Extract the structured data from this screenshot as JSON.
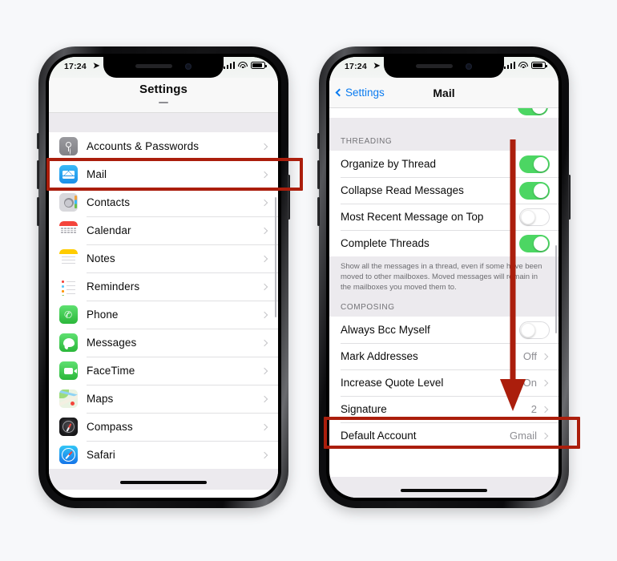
{
  "background_color": "#f7f8fa",
  "annotation_color": "#ab1e0c",
  "left_phone": {
    "status_bar": {
      "time": "17:24",
      "location_icon": "location-arrow-icon",
      "signal_icon": "cellular-bars-icon",
      "wifi_icon": "wifi-icon",
      "battery_icon": "battery-icon"
    },
    "nav": {
      "title": "Settings"
    },
    "items": [
      {
        "label": "Accounts & Passwords",
        "icon": "key-icon",
        "chevron": "chevron-right-icon"
      },
      {
        "label": "Mail",
        "icon": "mail-icon",
        "chevron": "chevron-right-icon",
        "highlighted": true
      },
      {
        "label": "Contacts",
        "icon": "contacts-icon",
        "chevron": "chevron-right-icon"
      },
      {
        "label": "Calendar",
        "icon": "calendar-icon",
        "chevron": "chevron-right-icon"
      },
      {
        "label": "Notes",
        "icon": "notes-icon",
        "chevron": "chevron-right-icon"
      },
      {
        "label": "Reminders",
        "icon": "reminders-icon",
        "chevron": "chevron-right-icon"
      },
      {
        "label": "Phone",
        "icon": "phone-icon",
        "chevron": "chevron-right-icon"
      },
      {
        "label": "Messages",
        "icon": "messages-icon",
        "chevron": "chevron-right-icon"
      },
      {
        "label": "FaceTime",
        "icon": "facetime-icon",
        "chevron": "chevron-right-icon"
      },
      {
        "label": "Maps",
        "icon": "maps-icon",
        "chevron": "chevron-right-icon"
      },
      {
        "label": "Compass",
        "icon": "compass-icon",
        "chevron": "chevron-right-icon"
      },
      {
        "label": "Safari",
        "icon": "safari-icon",
        "chevron": "chevron-right-icon"
      }
    ]
  },
  "right_phone": {
    "status_bar": {
      "time": "17:24",
      "location_icon": "location-arrow-icon",
      "signal_icon": "cellular-bars-icon",
      "wifi_icon": "wifi-icon",
      "battery_icon": "battery-icon"
    },
    "nav": {
      "back_label": "Settings",
      "title": "Mail"
    },
    "threading": {
      "header": "THREADING",
      "rows": [
        {
          "label": "Organize by Thread",
          "control": "toggle",
          "state": "on"
        },
        {
          "label": "Collapse Read Messages",
          "control": "toggle",
          "state": "on"
        },
        {
          "label": "Most Recent Message on Top",
          "control": "toggle",
          "state": "off"
        },
        {
          "label": "Complete Threads",
          "control": "toggle",
          "state": "on"
        }
      ],
      "footnote": "Show all the messages in a thread, even if some have been moved to other mailboxes. Moved messages will remain in the mailboxes you moved them to."
    },
    "composing": {
      "header": "COMPOSING",
      "rows": [
        {
          "label": "Always Bcc Myself",
          "control": "toggle",
          "state": "off"
        },
        {
          "label": "Mark Addresses",
          "control": "value",
          "value": "Off",
          "chevron": "chevron-right-icon"
        },
        {
          "label": "Increase Quote Level",
          "control": "value",
          "value": "On",
          "chevron": "chevron-right-icon"
        },
        {
          "label": "Signature",
          "control": "value",
          "value": "2",
          "chevron": "chevron-right-icon",
          "highlighted": true
        },
        {
          "label": "Default Account",
          "control": "value",
          "value": "Gmail",
          "chevron": "chevron-right-icon"
        }
      ]
    }
  },
  "annotations": {
    "mail_highlight": "red-highlight-box-mail",
    "signature_highlight": "red-highlight-box-signature",
    "down_arrow": "red-down-arrow"
  }
}
